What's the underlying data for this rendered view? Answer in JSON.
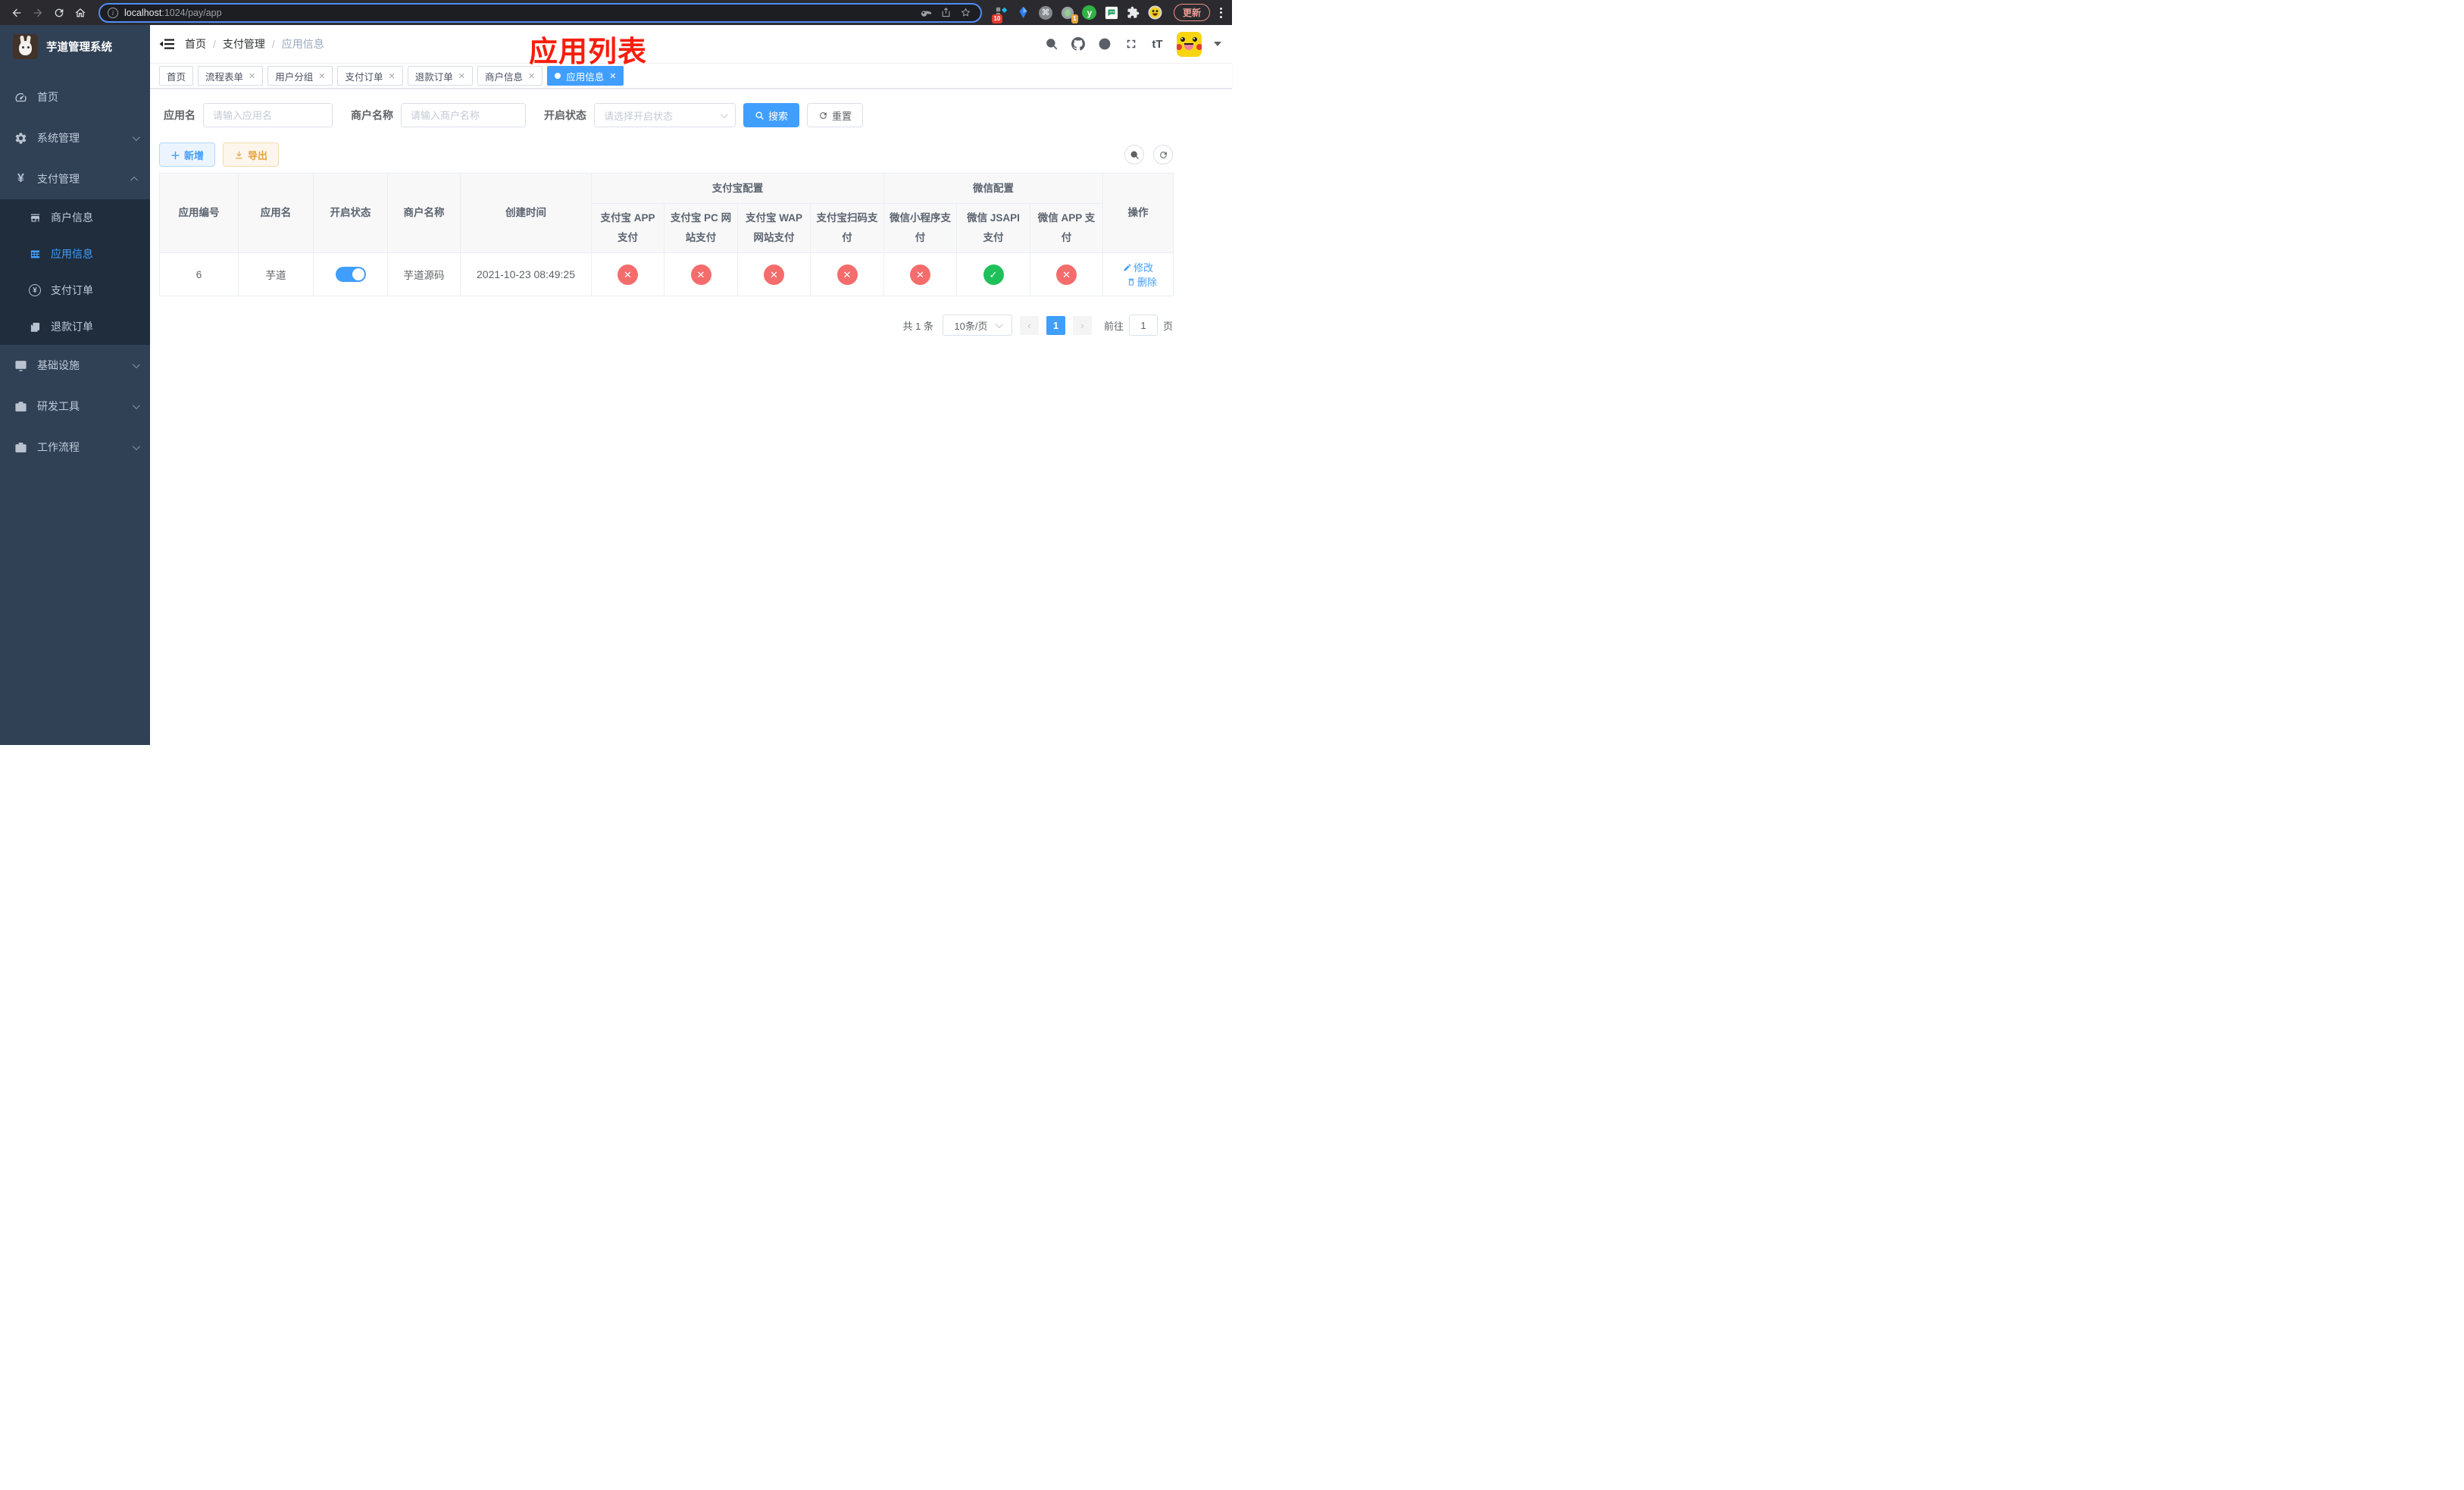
{
  "browser": {
    "url_primary": "localhost",
    "url_secondary": ":1024/pay/app",
    "update_label": "更新",
    "ext_badge_red": "10",
    "ext_badge_orange": "1",
    "ext_y_letter": "y",
    "cmd_glyph": "⌘"
  },
  "sidebar": {
    "title": "芋道管理系统",
    "items": [
      {
        "label": "首页"
      },
      {
        "label": "系统管理"
      },
      {
        "label": "支付管理",
        "children": [
          {
            "label": "商户信息"
          },
          {
            "label": "应用信息"
          },
          {
            "label": "支付订单"
          },
          {
            "label": "退款订单"
          }
        ]
      },
      {
        "label": "基础设施"
      },
      {
        "label": "研发工具"
      },
      {
        "label": "工作流程"
      }
    ]
  },
  "header": {
    "breadcrumb": [
      "首页",
      "支付管理",
      "应用信息"
    ],
    "separator": "/",
    "annotation": "应用列表",
    "font_size_icon": "tT"
  },
  "tabs": [
    {
      "label": "首页"
    },
    {
      "label": "流程表单"
    },
    {
      "label": "用户分组"
    },
    {
      "label": "支付订单"
    },
    {
      "label": "退款订单"
    },
    {
      "label": "商户信息"
    },
    {
      "label": "应用信息"
    }
  ],
  "search": {
    "app_label": "应用名",
    "app_placeholder": "请输入应用名",
    "merchant_label": "商户名称",
    "merchant_placeholder": "请输入商户名称",
    "status_label": "开启状态",
    "status_placeholder": "请选择开启状态",
    "search_label": "搜索",
    "reset_label": "重置"
  },
  "toolbar": {
    "add_label": "新增",
    "export_label": "导出"
  },
  "table": {
    "group_alipay": "支付宝配置",
    "group_wechat": "微信配置",
    "col_id": "应用编号",
    "col_name": "应用名",
    "col_status": "开启状态",
    "col_merchant": "商户名称",
    "col_created": "创建时间",
    "col_alipay_app": "支付宝 APP 支付",
    "col_alipay_pc": "支付宝 PC 网站支付",
    "col_alipay_wap": "支付宝 WAP 网站支付",
    "col_alipay_qr": "支付宝扫码支付",
    "col_wx_mini": "微信小程序支付",
    "col_wx_jsapi": "微信 JSAPI 支付",
    "col_wx_app": "微信 APP 支付",
    "col_actions": "操作",
    "row": {
      "id": "6",
      "name": "芋道",
      "enabled": true,
      "merchant": "芋道源码",
      "created": "2021-10-23 08:49:25",
      "channels": [
        false,
        false,
        false,
        false,
        false,
        true,
        false
      ],
      "edit_label": "修改",
      "delete_label": "删除"
    }
  },
  "pagination": {
    "total": "共 1 条",
    "page_size": "10条/页",
    "current_page": "1",
    "goto_label": "前往",
    "goto_value": "1",
    "unit_label": "页"
  },
  "colors": {
    "primary": "#409eff",
    "success": "#1fc05a",
    "danger": "#f56c6c",
    "warning": "#e6a23c",
    "sidebar": "#304156"
  }
}
